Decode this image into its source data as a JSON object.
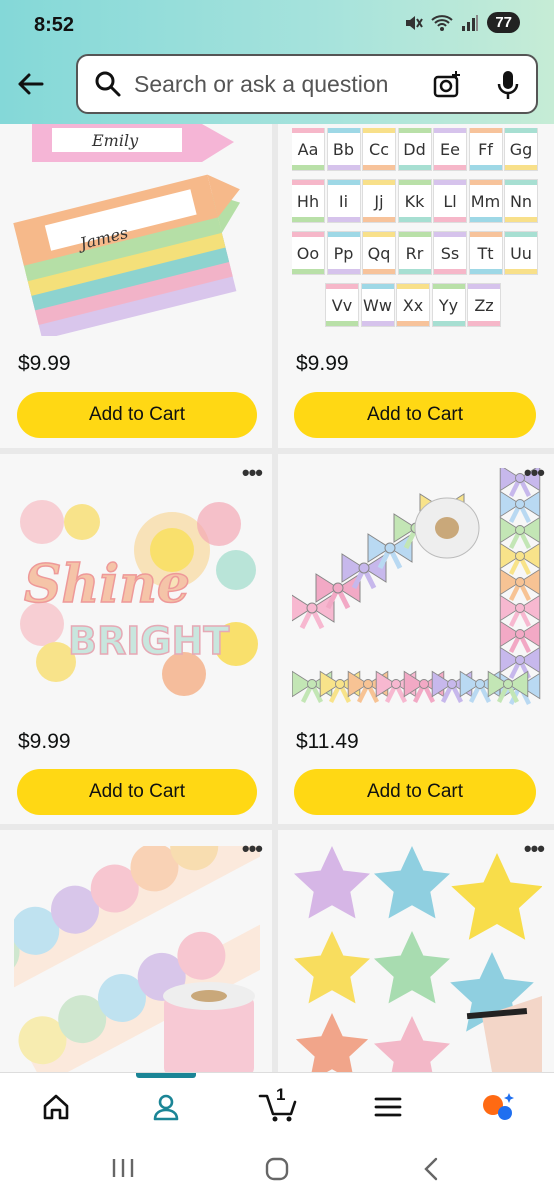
{
  "status": {
    "time": "8:52",
    "battery": "77"
  },
  "search": {
    "placeholder": "Search or ask a question"
  },
  "products": [
    {
      "price": "$9.99",
      "cta": "Add to Cart",
      "name1": "Emily",
      "name2": "James"
    },
    {
      "price": "$9.99",
      "cta": "Add to Cart",
      "letters": [
        "Aa",
        "Bb",
        "Cc",
        "Dd",
        "Ee",
        "Ff",
        "Gg",
        "Hh",
        "Ii",
        "Jj",
        "Kk",
        "Ll",
        "Mm",
        "Nn",
        "Oo",
        "Pp",
        "Qq",
        "Rr",
        "Ss",
        "Tt",
        "Uu",
        "Vv",
        "Ww",
        "Xx",
        "Yy",
        "Zz"
      ]
    },
    {
      "price": "$9.99",
      "cta": "Add to Cart",
      "text1": "Shine",
      "text2": "BRIGHT"
    },
    {
      "price": "$11.49",
      "cta": "Add to Cart"
    },
    {},
    {}
  ],
  "nav": {
    "cart_count": "1"
  },
  "colors": {
    "accent": "#ffd814",
    "teal": "#1b8596"
  }
}
